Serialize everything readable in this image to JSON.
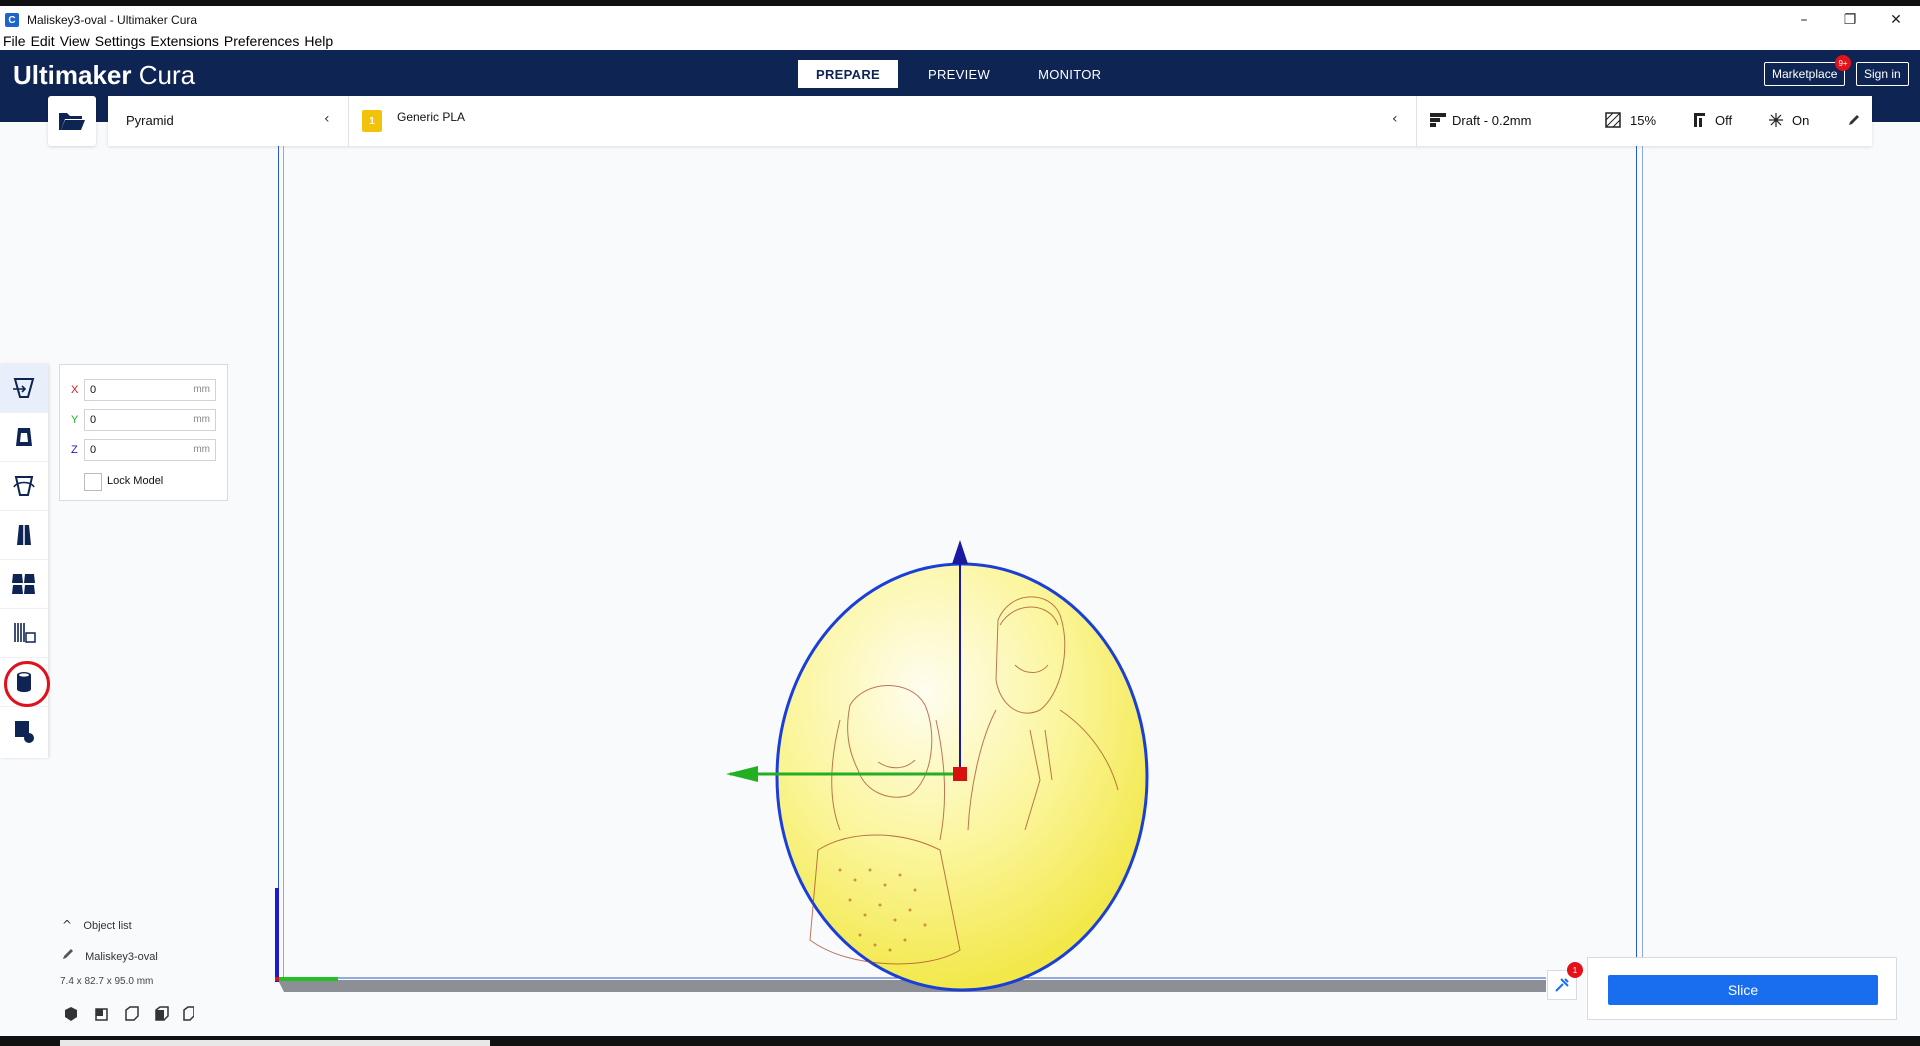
{
  "window": {
    "title": "Maliskey3-oval - Ultimaker Cura",
    "app_icon_glyph": "C",
    "minimize_glyph": "–",
    "restore_glyph": "❐",
    "close_glyph": "✕"
  },
  "menu": [
    "File",
    "Edit",
    "View",
    "Settings",
    "Extensions",
    "Preferences",
    "Help"
  ],
  "header": {
    "brand_bold": "Ultimaker",
    "brand_light": "Cura",
    "tabs": [
      "PREPARE",
      "PREVIEW",
      "MONITOR"
    ],
    "active_tab": "PREPARE",
    "marketplace_label": "Marketplace",
    "marketplace_badge": "9+",
    "signin_label": "Sign in"
  },
  "config": {
    "printer": "Pyramid",
    "extruder_number": "1",
    "material": "Generic PLA",
    "profile": "Draft - 0.2mm",
    "infill": "15%",
    "support": "Off",
    "adhesion": "On"
  },
  "move_tool": {
    "x_label": "X",
    "x_value": "0",
    "y_label": "Y",
    "y_value": "0",
    "z_label": "Z",
    "z_value": "0",
    "unit": "mm",
    "lock_label": "Lock Model"
  },
  "object_list": {
    "toggle_label": "Object list",
    "object_name": "Maliskey3-oval",
    "dimensions": "7.4 x 82.7 x 95.0 mm"
  },
  "slice": {
    "button_label": "Slice",
    "notification_count": "1"
  },
  "colors": {
    "header_bg": "#0e2453",
    "accent_blue": "#196ef0",
    "model_fill": "#f7f06a",
    "model_outline": "#1a3fd8",
    "annotation_red": "#e0101c"
  },
  "icons": {
    "open": "folder-open-icon",
    "profile": "profile-icon",
    "infill": "infill-icon",
    "support": "support-icon",
    "adhesion": "adhesion-icon",
    "edit": "pencil-icon"
  }
}
